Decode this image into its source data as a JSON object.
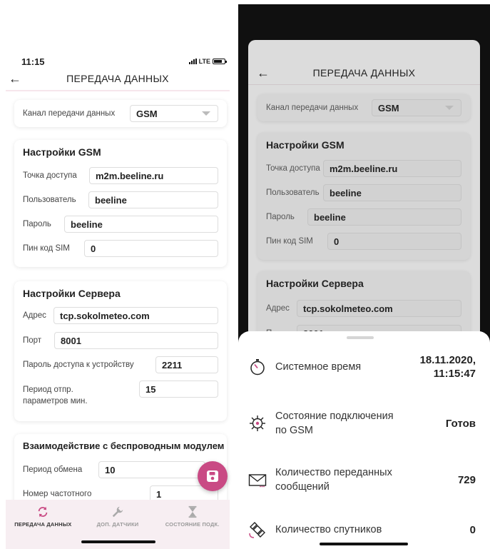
{
  "status_bar": {
    "time": "11:15",
    "network": "LTE"
  },
  "header": {
    "title": "ПЕРЕДАЧА ДАННЫХ"
  },
  "channel": {
    "label": "Канал передачи данных",
    "value": "GSM"
  },
  "gsm": {
    "title": "Настройки GSM",
    "apn_label": "Точка доступа",
    "apn": "m2m.beeline.ru",
    "user_label": "Пользователь",
    "user": "beeline",
    "password_label": "Пароль",
    "password": "beeline",
    "pin_label": "Пин код SIM",
    "pin": "0"
  },
  "server": {
    "title": "Настройки Сервера",
    "address_label": "Адрес",
    "address": "tcp.sokolmeteo.com",
    "port_label": "Порт",
    "port": "8001",
    "device_password_label": "Пароль доступа к устройству",
    "device_password": "2211",
    "period_label_1": "Период отпр.",
    "period_label_2": "параметров мин.",
    "period": "15",
    "right_port_label_partial": "П"
  },
  "wireless": {
    "title": "Взаимодействие с беспроводным модулем",
    "exchange_label": "Период обмена",
    "exchange": "10",
    "frequency_label": "Номер частотного",
    "frequency": "1"
  },
  "bottom_nav": [
    {
      "label": "ПЕРЕДАЧА ДАННЫХ",
      "icon": "sync-icon",
      "active": true
    },
    {
      "label": "ДОП. ДАТЧИКИ",
      "icon": "wrench-icon",
      "active": false
    },
    {
      "label": "СОСТОЯНИЕ ПОДК.",
      "icon": "hourglass-icon",
      "active": false
    }
  ],
  "sheet": {
    "rows": [
      {
        "label": "Системное время",
        "value_1": "18.11.2020,",
        "value_2": "11:15:47",
        "icon": "stopwatch-icon"
      },
      {
        "label_1": "Состояние подключения",
        "label_2": "по GSM",
        "value": "Готов",
        "icon": "gear-icon"
      },
      {
        "label_1": "Количество переданных",
        "label_2": "сообщений",
        "value": "729",
        "icon": "envelope-icon"
      },
      {
        "label": "Количество спутников",
        "value": "0",
        "icon": "satellite-icon"
      }
    ]
  },
  "colors": {
    "accent": "#c94a84",
    "header_line": "#f6e6ec",
    "sheet_bg": "#ffffff",
    "dim_overlay": "#dcdcdc"
  }
}
